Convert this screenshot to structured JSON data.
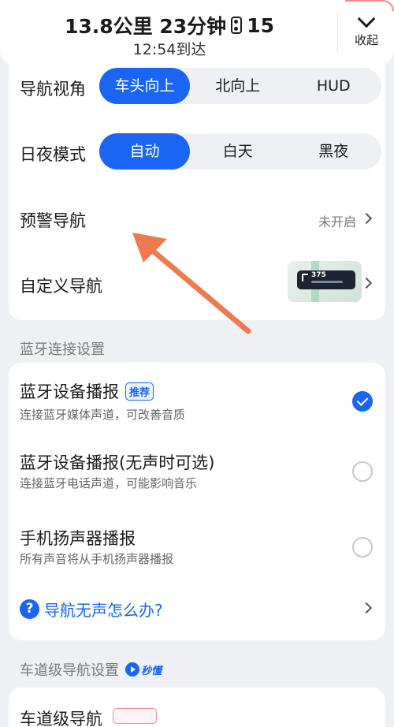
{
  "header": {
    "distance_time": "13.8公里 23分钟",
    "signal_count": "15",
    "arrival": "12:54到达",
    "collapse_label": "收起"
  },
  "nav_view": {
    "label": "导航视角",
    "options": [
      "车头向上",
      "北向上",
      "HUD"
    ],
    "selected": "车头向上"
  },
  "day_night": {
    "label": "日夜模式",
    "options": [
      "自动",
      "白天",
      "黑夜"
    ],
    "selected": "自动"
  },
  "warning_nav": {
    "label": "预警导航",
    "value": "未开启"
  },
  "custom_nav": {
    "label": "自定义导航",
    "thumb_number": "375"
  },
  "bluetooth_section": {
    "title": "蓝牙连接设置",
    "options": [
      {
        "title": "蓝牙设备播报",
        "tag": "推荐",
        "subtitle": "连接蓝牙媒体声道，可改善音质",
        "checked": true
      },
      {
        "title": "蓝牙设备播报(无声时可选)",
        "tag": "",
        "subtitle": "连接蓝牙电话声道，可能影响音乐",
        "checked": false
      },
      {
        "title": "手机扬声器播报",
        "tag": "",
        "subtitle": "所有声音将从手机扬声器播报",
        "checked": false
      }
    ],
    "help_text": "导航无声怎么办?"
  },
  "lane_section": {
    "title": "车道级导航设置",
    "badge": "秒懂",
    "item_partial": "车道级导航"
  },
  "colors": {
    "accent": "#1a66f2",
    "annotation": "#f07a50"
  }
}
